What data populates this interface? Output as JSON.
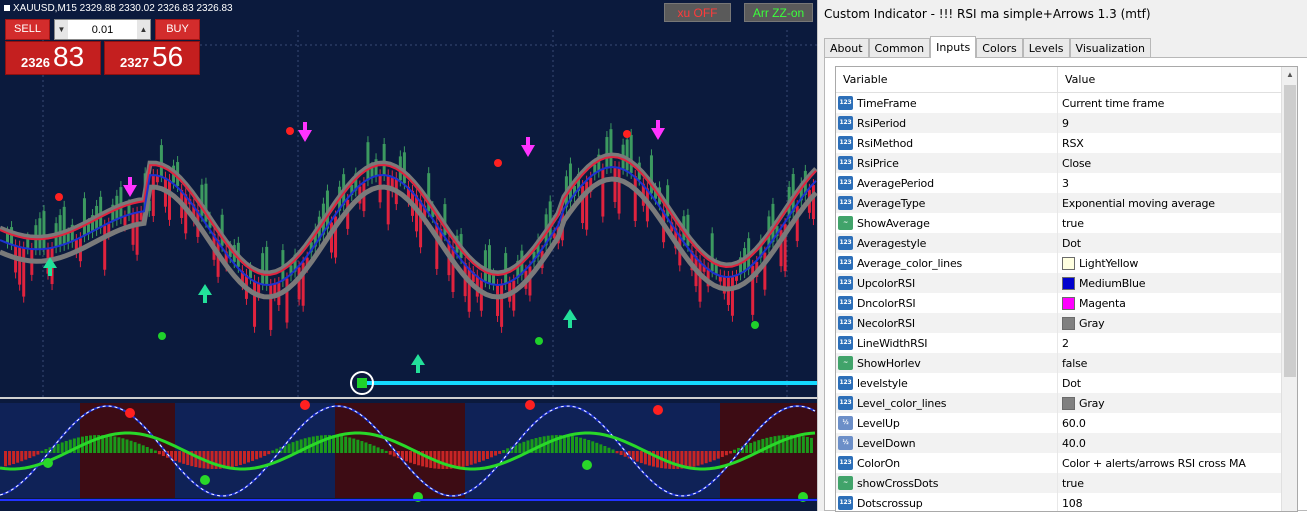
{
  "chart": {
    "symbol_line": "XAUUSD,M15  2329.88 2330.02 2326.83 2326.83",
    "trade_panel": {
      "sell_label": "SELL",
      "buy_label": "BUY",
      "lot_value": "0.01",
      "sell_price_small": "2326",
      "sell_price_big": "83",
      "buy_price_small": "2327",
      "buy_price_big": "56"
    },
    "button_xu": "xu OFF",
    "button_arr": "Arr ZZ-on",
    "colors": {
      "background": "#0b1a3d",
      "bull_candle": "#3c9a60",
      "bear_candle": "#e0233e",
      "line_upper": "#e0233e",
      "line_lower": "#1c31d1",
      "down_arrow": "#ff33ff",
      "up_arrow": "#23e09a"
    }
  },
  "dialog": {
    "title": "Custom Indicator - !!! RSI ma simple+Arrows 1.3 (mtf)",
    "tabs": [
      "About",
      "Common",
      "Inputs",
      "Colors",
      "Levels",
      "Visualization"
    ],
    "active_tab": "Inputs",
    "grid_header": {
      "variable": "Variable",
      "value": "Value"
    },
    "rows": [
      {
        "var": "TimeFrame",
        "val": "Current time frame",
        "icon": "enum-icon"
      },
      {
        "var": "RsiPeriod",
        "val": "9",
        "icon": "int-icon"
      },
      {
        "var": "RsiMethod",
        "val": "RSX",
        "icon": "enum-icon"
      },
      {
        "var": "RsiPrice",
        "val": "Close",
        "icon": "enum-icon"
      },
      {
        "var": "AveragePeriod",
        "val": "3",
        "icon": "int-icon"
      },
      {
        "var": "AverageType",
        "val": "Exponential moving average",
        "icon": "enum-icon"
      },
      {
        "var": "ShowAverage",
        "val": "true",
        "icon": "bool-icon"
      },
      {
        "var": "Averagestyle",
        "val": "Dot",
        "icon": "enum-icon"
      },
      {
        "var": "Average_color_lines",
        "val": "LightYellow",
        "icon": "color-icon",
        "swatch": "#ffffe0"
      },
      {
        "var": "UpcolorRSI",
        "val": "MediumBlue",
        "icon": "color-icon",
        "swatch": "#0000cd"
      },
      {
        "var": "DncolorRSI",
        "val": "Magenta",
        "icon": "color-icon",
        "swatch": "#ff00ff"
      },
      {
        "var": "NecolorRSI",
        "val": "Gray",
        "icon": "color-icon",
        "swatch": "#808080"
      },
      {
        "var": "LineWidthRSI",
        "val": "2",
        "icon": "int-icon"
      },
      {
        "var": "ShowHorlev",
        "val": "false",
        "icon": "bool-icon"
      },
      {
        "var": "levelstyle",
        "val": "Dot",
        "icon": "enum-icon"
      },
      {
        "var": "Level_color_lines",
        "val": "Gray",
        "icon": "color-icon",
        "swatch": "#808080"
      },
      {
        "var": "LevelUp",
        "val": "60.0",
        "icon": "double-icon"
      },
      {
        "var": "LevelDown",
        "val": "40.0",
        "icon": "double-icon"
      },
      {
        "var": "ColorOn",
        "val": "Color + alerts/arrows RSI cross MA",
        "icon": "enum-icon"
      },
      {
        "var": "showCrossDots",
        "val": "true",
        "icon": "bool-icon"
      },
      {
        "var": "Dotscrossup",
        "val": "108",
        "icon": "int-icon"
      }
    ]
  }
}
